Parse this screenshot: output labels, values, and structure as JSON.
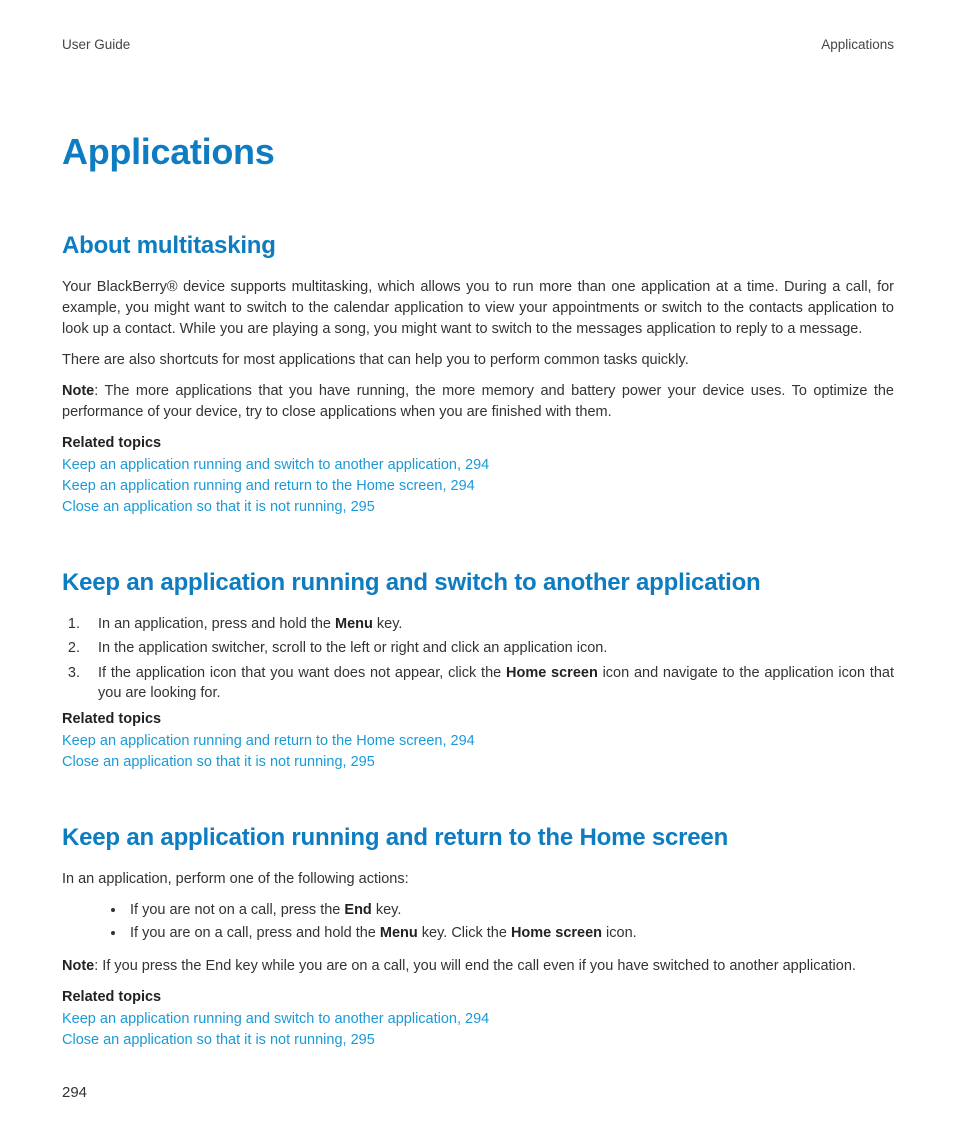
{
  "header": {
    "left": "User Guide",
    "right": "Applications"
  },
  "title": "Applications",
  "sections": {
    "about": {
      "heading": "About multitasking",
      "p1": "Your BlackBerry® device supports multitasking, which allows you to run more than one application at a time. During a call, for example, you might want to switch to the calendar application to view your appointments or switch to the contacts application to look up a contact. While you are playing a song, you might want to switch to the messages application to reply to a message.",
      "p2": "There are also shortcuts for most applications that can help you to perform common tasks quickly.",
      "note_label": "Note",
      "note_text": ":  The more applications that you have running, the more memory and battery power your device uses. To optimize the performance of your device, try to close applications when you are finished with them.",
      "related_heading": "Related topics",
      "links": {
        "l1": "Keep an application running and switch to another application, 294",
        "l2": "Keep an application running and return to the Home screen, 294",
        "l3": "Close an application so that it is not running, 295"
      }
    },
    "switch": {
      "heading": "Keep an application running and switch to another application",
      "step1_a": "In an application, press and hold the ",
      "step1_b": "Menu",
      "step1_c": " key.",
      "step2": "In the application switcher, scroll to the left or right and click an application icon.",
      "step3_a": "If the application icon that you want does not appear, click the ",
      "step3_b": "Home screen",
      "step3_c": " icon and navigate to the application icon that you are looking for.",
      "related_heading": "Related topics",
      "links": {
        "l1": "Keep an application running and return to the Home screen, 294",
        "l2": "Close an application so that it is not running, 295"
      }
    },
    "home": {
      "heading": "Keep an application running and return to the Home screen",
      "intro": "In an application, perform one of the following actions:",
      "b1_a": "If you are not on a call, press the ",
      "b1_b": "End",
      "b1_c": " key.",
      "b2_a": "If you are on a call, press and hold the ",
      "b2_b": "Menu",
      "b2_c": " key. Click the ",
      "b2_d": "Home screen",
      "b2_e": " icon.",
      "note_label": "Note",
      "note_text": ":  If you press the End key while you are on a call, you will end the call even if you have switched to another application.",
      "related_heading": "Related topics",
      "links": {
        "l1": "Keep an application running and switch to another application, 294",
        "l2": "Close an application so that it is not running, 295"
      }
    }
  },
  "page_number": "294"
}
